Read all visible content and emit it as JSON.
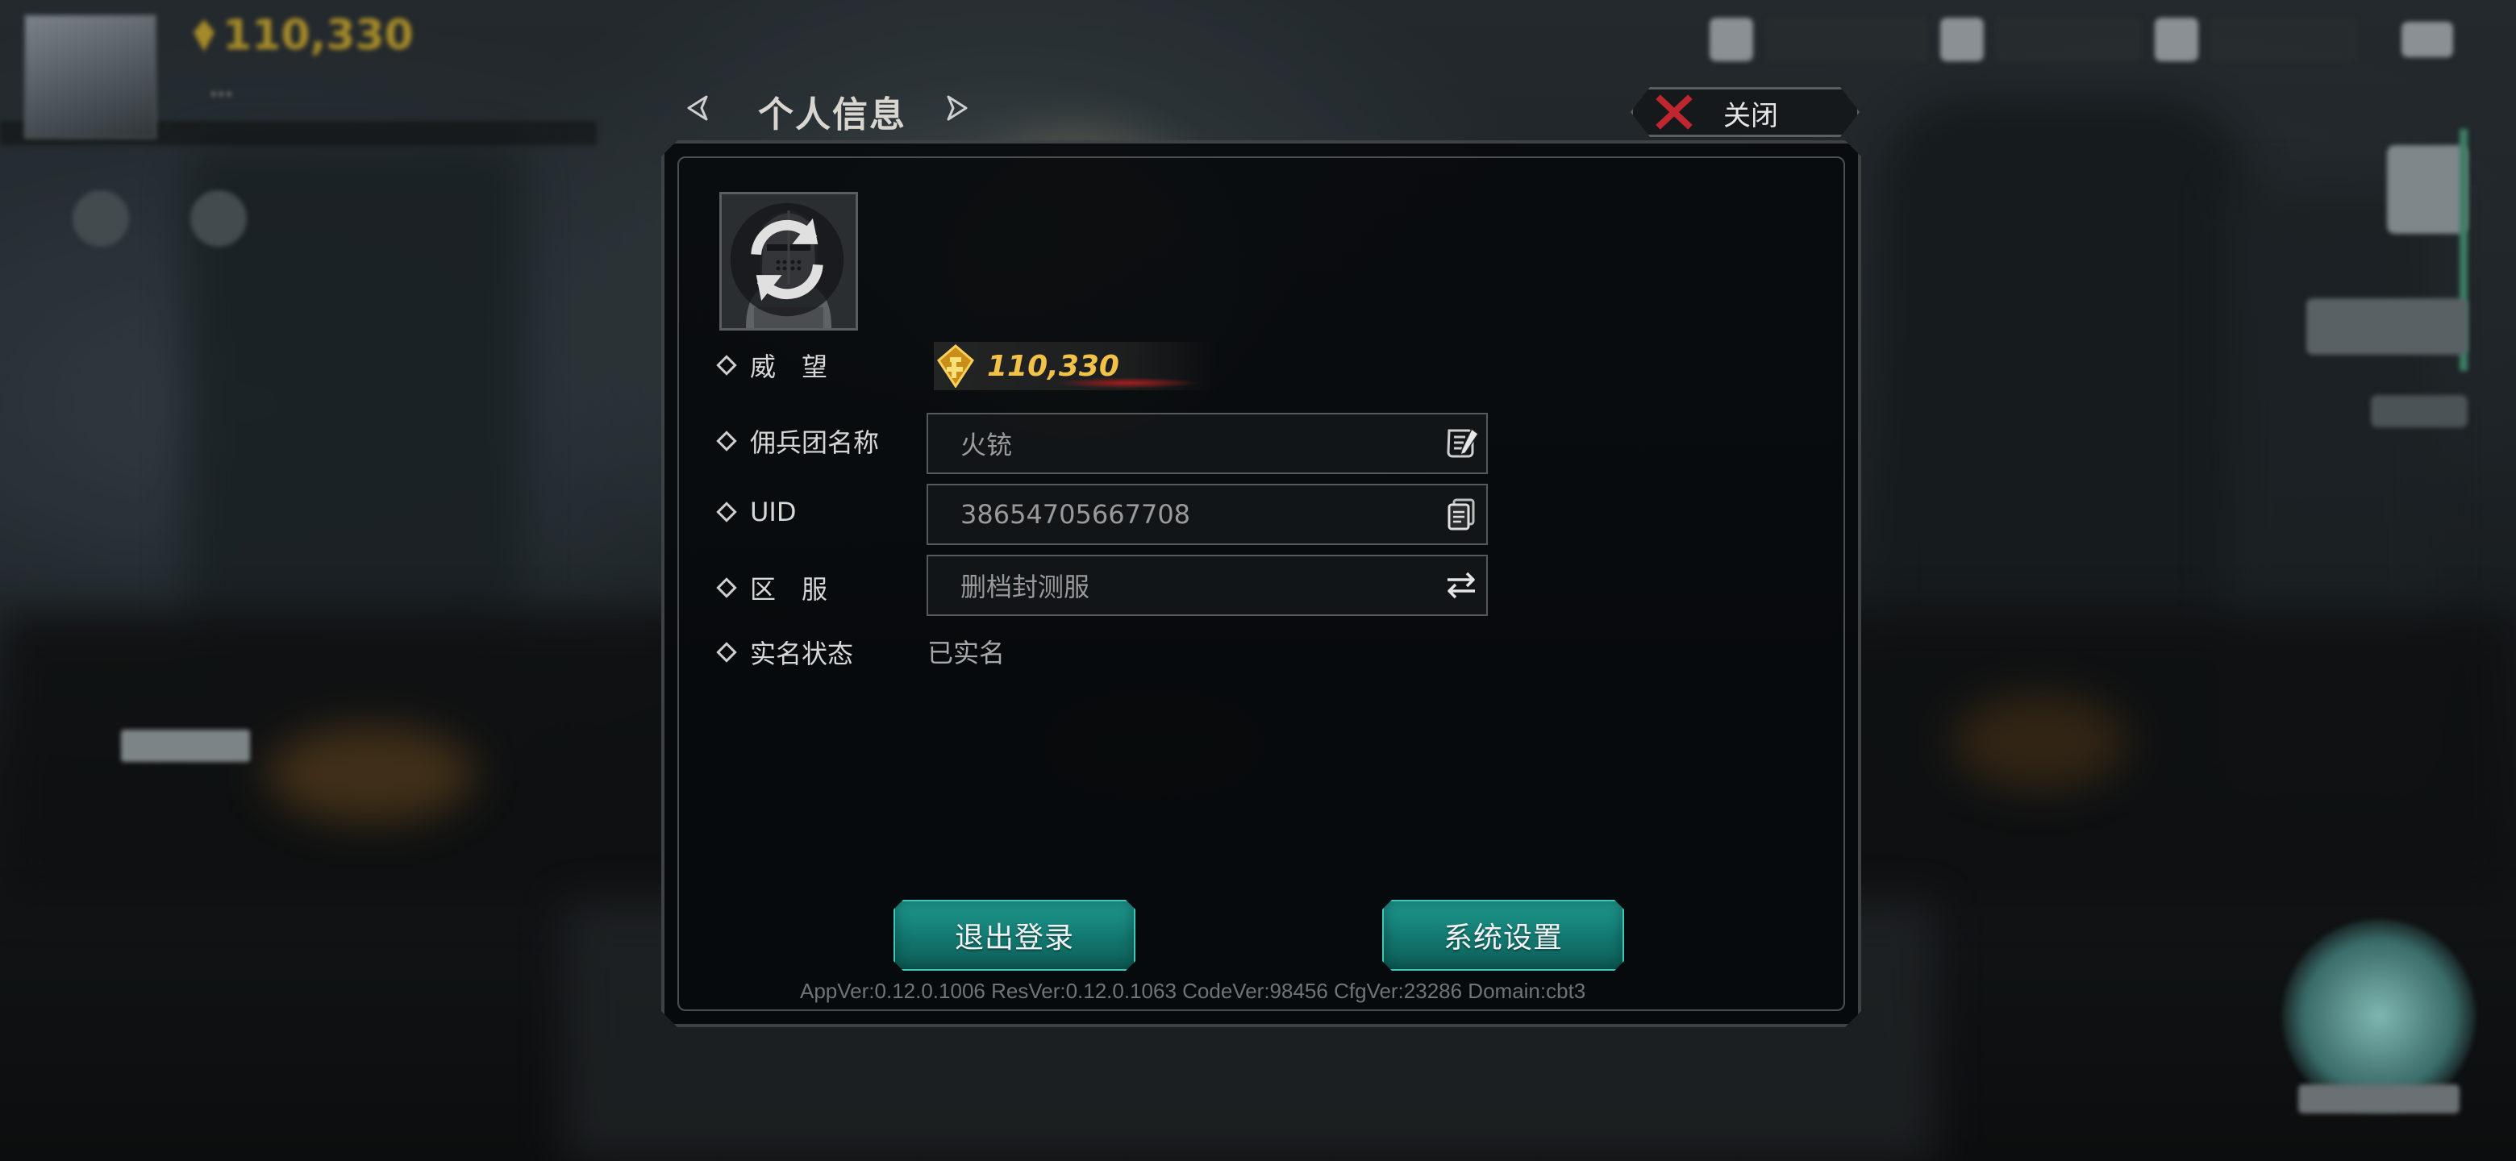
{
  "header": {
    "title": "个人信息",
    "close_label": "关闭"
  },
  "profile": {
    "prestige_label": "威　望",
    "prestige_value": "110,330",
    "guild_name_label": "佣兵团名称",
    "guild_name_value": "火铳",
    "uid_label": "UID",
    "uid_value": "38654705667708",
    "server_label": "区　服",
    "server_value": "删档封测服",
    "realname_label": "实名状态",
    "realname_value": "已实名"
  },
  "buttons": {
    "logout": "退出登录",
    "settings": "系统设置"
  },
  "version_info": "AppVer:0.12.0.1006  ResVer:0.12.0.1063  CodeVer:98456  CfgVer:23286  Domain:cbt3",
  "background_hud": {
    "coin_value": "110,330"
  },
  "icons": {
    "prev": "chevron-left-icon",
    "next": "chevron-right-icon",
    "close": "close-x-icon",
    "rename": "edit-scroll-icon",
    "copy": "copy-icon",
    "switch": "swap-arrows-icon",
    "avatar_swap": "refresh-icon",
    "prestige": "prestige-coin-icon"
  },
  "colors": {
    "accent_teal": "#1f9a8f",
    "prestige_gold": "#f2c14a",
    "close_red": "#c0262d"
  }
}
